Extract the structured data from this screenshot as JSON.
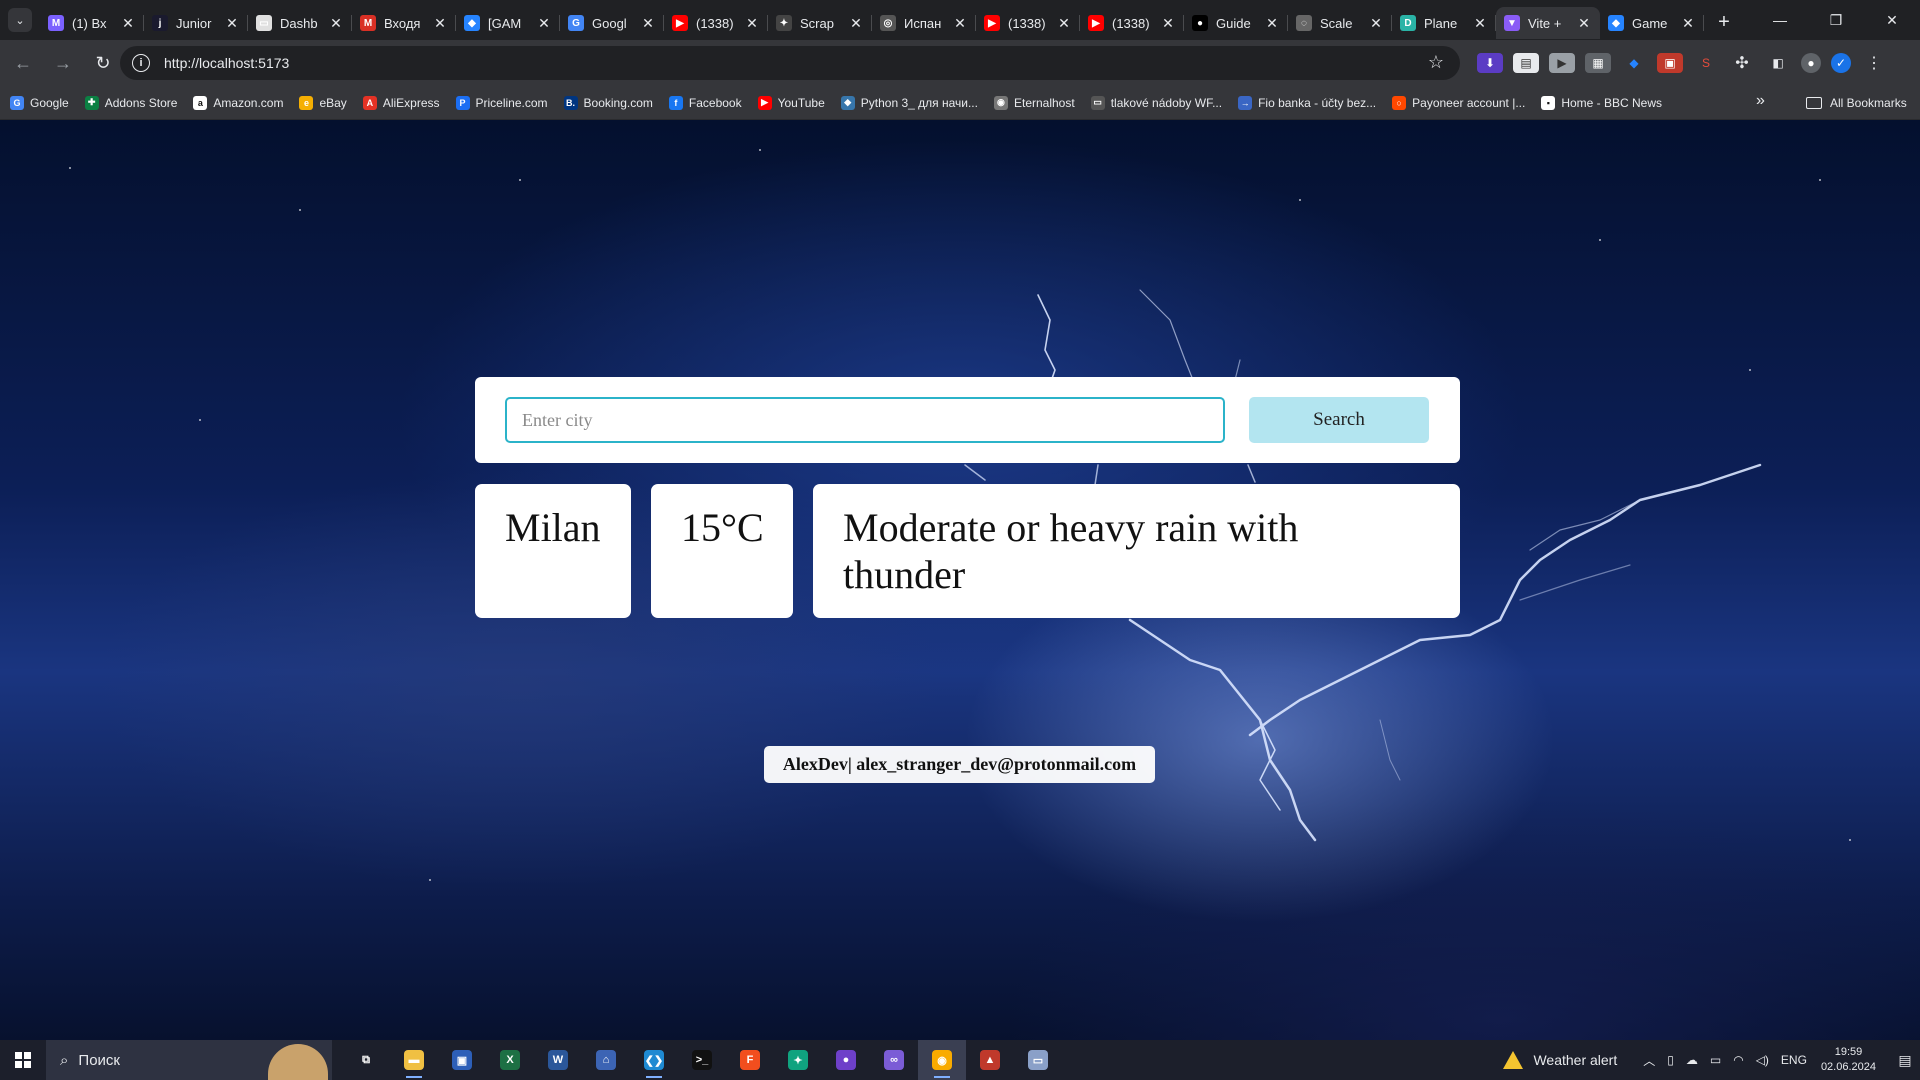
{
  "browser": {
    "tabs": [
      {
        "title": "(1) Вх",
        "icon": "gmail-icon",
        "color": "#7b61ff",
        "glyph": "M"
      },
      {
        "title": "Junior",
        "icon": "junior-icon",
        "color": "#1a1a2e",
        "glyph": "j"
      },
      {
        "title": "Dashb",
        "icon": "dashboard-icon",
        "color": "#e0e0e0",
        "glyph": "▭"
      },
      {
        "title": "Входя",
        "icon": "gmail-icon",
        "color": "#d93025",
        "glyph": "M"
      },
      {
        "title": "[GAM",
        "icon": "jira-icon",
        "color": "#2684ff",
        "glyph": "◆"
      },
      {
        "title": "Googl",
        "icon": "google-translate-icon",
        "color": "#4285f4",
        "glyph": "G"
      },
      {
        "title": "(1338)",
        "icon": "youtube-icon",
        "color": "#ff0000",
        "glyph": "▶"
      },
      {
        "title": "Scrap",
        "icon": "openai-icon",
        "color": "#444",
        "glyph": "✦"
      },
      {
        "title": "Испан",
        "icon": "globe-icon",
        "color": "#555",
        "glyph": "◎"
      },
      {
        "title": "(1338)",
        "icon": "youtube-icon",
        "color": "#ff0000",
        "glyph": "▶"
      },
      {
        "title": "(1338)",
        "icon": "youtube-icon",
        "color": "#ff0000",
        "glyph": "▶"
      },
      {
        "title": "Guide",
        "icon": "medium-icon",
        "color": "#000",
        "glyph": "●"
      },
      {
        "title": "Scale",
        "icon": "scale-icon",
        "color": "#666",
        "glyph": "◌"
      },
      {
        "title": "Plane",
        "icon": "planet-icon",
        "color": "#2ab3a6",
        "glyph": "D"
      },
      {
        "title": "Vite +",
        "icon": "vite-icon",
        "color": "#8a5cf6",
        "glyph": "▼",
        "active": true
      },
      {
        "title": "Game",
        "icon": "jira-icon",
        "color": "#2684ff",
        "glyph": "◆"
      }
    ],
    "address": "http://localhost:5173",
    "bookmarks": [
      {
        "label": "Google",
        "icon": "google-icon",
        "color": "#4285f4",
        "glyph": "G"
      },
      {
        "label": "Addons Store",
        "icon": "addons-icon",
        "color": "#0b8043",
        "glyph": "✚"
      },
      {
        "label": "Amazon.com",
        "icon": "amazon-icon",
        "color": "#fff",
        "glyph": "a"
      },
      {
        "label": "eBay",
        "icon": "ebay-icon",
        "color": "#f5af02",
        "glyph": "e"
      },
      {
        "label": "AliExpress",
        "icon": "aliexpress-icon",
        "color": "#e43225",
        "glyph": "A"
      },
      {
        "label": "Priceline.com",
        "icon": "priceline-icon",
        "color": "#1b6ef3",
        "glyph": "P"
      },
      {
        "label": "Booking.com",
        "icon": "booking-icon",
        "color": "#003580",
        "glyph": "B."
      },
      {
        "label": "Facebook",
        "icon": "facebook-icon",
        "color": "#1877f2",
        "glyph": "f"
      },
      {
        "label": "YouTube",
        "icon": "youtube-icon",
        "color": "#ff0000",
        "glyph": "▶"
      },
      {
        "label": "Python 3_ для начи...",
        "icon": "python-icon",
        "color": "#3776ab",
        "glyph": "◆"
      },
      {
        "label": "Eternalhost",
        "icon": "eternalhost-icon",
        "color": "#777",
        "glyph": "◉"
      },
      {
        "label": "tlakové nádoby WF...",
        "icon": "page-icon",
        "color": "#555",
        "glyph": "▭"
      },
      {
        "label": "Fio banka - účty bez...",
        "icon": "fio-icon",
        "color": "#3a66c4",
        "glyph": "→"
      },
      {
        "label": "Payoneer account |...",
        "icon": "payoneer-icon",
        "color": "#ff4800",
        "glyph": "○"
      },
      {
        "label": "Home - BBC News",
        "icon": "bbc-icon",
        "color": "#fff",
        "glyph": "▪"
      }
    ],
    "all_bookmarks": "All Bookmarks"
  },
  "app": {
    "search": {
      "placeholder": "Enter city",
      "value": "",
      "button": "Search"
    },
    "weather": {
      "city": "Milan",
      "temperature": "15°C",
      "condition": "Moderate or heavy rain with thunder"
    },
    "footer": "AlexDev| alex_stranger_dev@protonmail.com"
  },
  "taskbar": {
    "search_placeholder": "Поиск",
    "apps": [
      {
        "name": "task-view-icon",
        "color": "transparent",
        "glyph": "⧉"
      },
      {
        "name": "file-explorer-icon",
        "color": "#f0c043",
        "glyph": "▬",
        "open": true
      },
      {
        "name": "save-app-icon",
        "color": "#2d5fb8",
        "glyph": "▣"
      },
      {
        "name": "excel-icon",
        "color": "#1d7044",
        "glyph": "X"
      },
      {
        "name": "word-icon",
        "color": "#2b579a",
        "glyph": "W"
      },
      {
        "name": "network-app-icon",
        "color": "#3c64b4",
        "glyph": "⌂"
      },
      {
        "name": "vscode-icon",
        "color": "#1f8ad2",
        "glyph": "❮❯",
        "open": true
      },
      {
        "name": "terminal-icon",
        "color": "#111",
        "glyph": ">_"
      },
      {
        "name": "figma-icon",
        "color": "#f24e1e",
        "glyph": "F"
      },
      {
        "name": "chatgpt-icon",
        "color": "#10a37f",
        "glyph": "✦"
      },
      {
        "name": "github-icon",
        "color": "#6e40c9",
        "glyph": "●"
      },
      {
        "name": "visual-studio-icon",
        "color": "#7b5cd6",
        "glyph": "∞"
      },
      {
        "name": "chrome-canary-icon",
        "color": "#f9ab00",
        "glyph": "◉",
        "open": true,
        "active": true
      },
      {
        "name": "game-app-icon",
        "color": "#c0392b",
        "glyph": "▲"
      },
      {
        "name": "remote-desktop-icon",
        "color": "#8aa0c8",
        "glyph": "▭"
      }
    ],
    "weather_alert": "Weather alert",
    "language": "ENG",
    "time": "19:59",
    "date": "02.06.2024"
  }
}
